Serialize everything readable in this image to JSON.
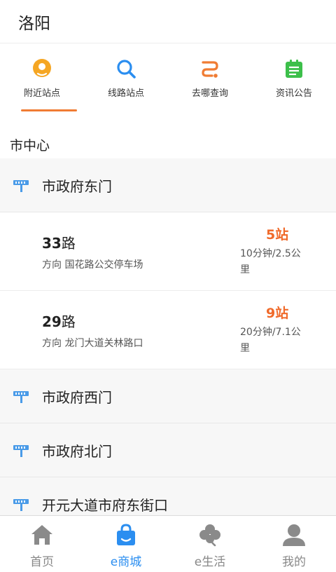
{
  "header": {
    "city": "洛阳"
  },
  "tabs": [
    {
      "label": "附近站点",
      "icon": "location-pin-icon",
      "color": "#f5a623",
      "active": true
    },
    {
      "label": "线路站点",
      "icon": "search-icon",
      "color": "#2b8ef0",
      "active": false
    },
    {
      "label": "去哪查询",
      "icon": "route-icon",
      "color": "#f07c33",
      "active": false
    },
    {
      "label": "资讯公告",
      "icon": "news-icon",
      "color": "#3cbf4a",
      "active": false
    }
  ],
  "accent_color": "#f07c33",
  "area": {
    "title": "市中心"
  },
  "stops": [
    {
      "name": "市政府东门",
      "routes": [
        {
          "number": "33",
          "suffix": "路",
          "direction": "方向 国花路公交停车场",
          "stops_away": "5站",
          "info": "10分钟/2.5公里"
        },
        {
          "number": "29",
          "suffix": "路",
          "direction": "方向 龙门大道关林路口",
          "stops_away": "9站",
          "info": "20分钟/7.1公里"
        }
      ]
    },
    {
      "name": "市政府西门"
    },
    {
      "name": "市政府北门"
    },
    {
      "name": "开元大道市府东街口"
    }
  ],
  "bottom_nav": [
    {
      "label": "首页",
      "icon": "home-icon",
      "active": false
    },
    {
      "label": "e商城",
      "icon": "shopping-bag-icon",
      "active": true
    },
    {
      "label": "e生活",
      "icon": "clover-icon",
      "active": false
    },
    {
      "label": "我的",
      "icon": "user-icon",
      "active": false
    }
  ]
}
